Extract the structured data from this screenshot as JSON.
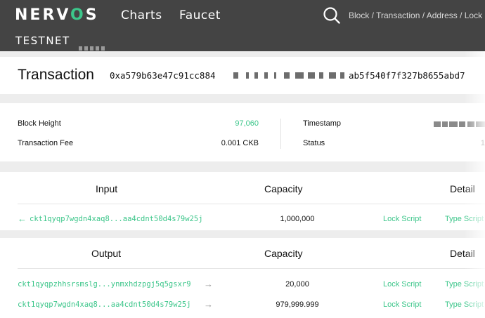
{
  "header": {
    "logo": {
      "pre": "NERV",
      "accent": "O",
      "post": "S"
    },
    "nav": {
      "charts": "Charts",
      "faucet": "Faucet"
    },
    "search_placeholder": "Block / Transaction / Address / Lock Hash",
    "network": "TESTNET"
  },
  "transaction": {
    "title": "Transaction",
    "hash_start": "0xa579b63e47c91cc884",
    "hash_end": "ab5f540f7f327b8655abd7"
  },
  "overview": {
    "block_height_label": "Block Height",
    "block_height_value": "97,060",
    "fee_label": "Transaction Fee",
    "fee_value": "0.001 CKB",
    "timestamp_label": "Timestamp",
    "status_label": "Status",
    "status_value_partial": "1"
  },
  "inputs": {
    "headers": {
      "address": "Input",
      "capacity": "Capacity",
      "detail": "Detail"
    },
    "rows": [
      {
        "address": "ckt1qyqp7wgdn4xaq8...aa4cdnt50d4s79w25j",
        "capacity": "1,000,000",
        "lock": "Lock Script",
        "type": "Type Script"
      }
    ]
  },
  "outputs": {
    "headers": {
      "address": "Output",
      "capacity": "Capacity",
      "detail": "Detail"
    },
    "rows": [
      {
        "address": "ckt1qyqpzhhsrsmslg...ynmxhdzpgj5q5gsxr9",
        "capacity": "20,000",
        "lock": "Lock Script",
        "type": "Type Script"
      },
      {
        "address": "ckt1qyqp7wgdn4xaq8...aa4cdnt50d4s79w25j",
        "capacity": "979,999.999",
        "lock": "Lock Script",
        "type": "Type Script"
      }
    ]
  },
  "colors": {
    "accent": "#3cc68a",
    "header_bg": "#444444",
    "page_bg": "#ededed"
  },
  "icons": {
    "search": "search-icon",
    "input_arrow": "arrow-left-icon",
    "output_arrow": "arrow-right-icon"
  }
}
